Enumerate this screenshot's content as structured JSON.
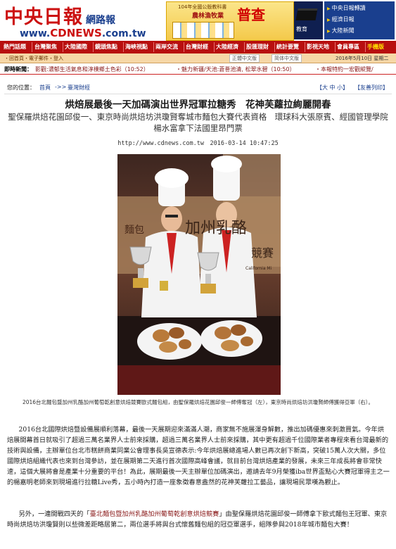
{
  "header": {
    "logo_title": "中央日報",
    "logo_sub": "網路報",
    "logo_url_prefix": "www.",
    "logo_url_brand": "CDNEWS",
    "logo_url_suffix": ".com.tw",
    "ad_label": "104年全國公版教科書",
    "ad_title": "農林漁牧業",
    "ad_big": "普查",
    "ad2_text": "教育",
    "right_links": [
      "中央日報轉讀",
      "經濟日報",
      "大陸新聞"
    ]
  },
  "nav": {
    "items": [
      "熱門話題",
      "台灣聚焦",
      "大陸國際",
      "鏡頭焦點",
      "海峽視點",
      "兩岸交流",
      "台灣財經",
      "大陸經濟",
      "股匯理財",
      "統計要覽",
      "影視天地",
      "會員專區",
      "手機版"
    ]
  },
  "subbar": {
    "left": "・回首頁・電子郵件・登入",
    "btn_traditional": "正體中文版",
    "btn_simplified": "简体中文版",
    "date": "2016年5月10日 星期二"
  },
  "ticker": {
    "label": "即時新聞：",
    "items": [
      "影觀:濃郁生活氣息和淳樸鄉土色彩（10:52）",
      "・魅力新疆/天池:蒼巻池清, 松翠水碧（10:50）",
      "・本報特約一宏觀縱覽/"
    ]
  },
  "breadcrumb": {
    "label": "您的位置：",
    "home": "首頁",
    "sep": "->>",
    "section": "臺灣財經",
    "font_size_label": "【大 中 小】",
    "print_label": "【友善列印】"
  },
  "article": {
    "headline": "烘焙展最後一天加碼演出世界冠軍拉糖秀　花神芙蘿拉絢麗開春",
    "subhead": "聖保羅烘焙花園邱俊一、東京時尚烘焙坊洪瓊賢奪城市麵包大賽代表資格　環球科大張原賓、經國管理學院楊水富拿下法國里昂門票",
    "meta": "http://www.cdnews.com.tw　2016-03-14 10:47:25",
    "photo_sign_top": "麵包",
    "photo_sign_main": "加州乳酪",
    "photo_sign_main2": "競賽",
    "photo_sign_small": "California Mi",
    "caption": "2016台北麵包暨加州乳酪加州葡萄乾創意烘焙競賽歐式麵包組，由聖保羅烘焙花園邱俊一師傅奪冠（左），東京時尚烘焙坊洪瓊賢師傅獲得亞軍（右）。",
    "para1": "2016台北國際烘焙暨設備展順利落幕，最後一天展期迎來滿滿人潮，商家無不施展渾身解數，推出加碼優惠來刺激買氣。今年烘焙展開幕首日就吸引了超過三萬名業界人士前來採購，超過三萬名業界人士前來採購，其中更有超過千位國際業者專程來看台灣最新的技術與設備，主辦單位台北市糕餅商業同業公會理事長吳宣德表示:今年烘焙展總進場人數已再次創下新高，突破15萬人次大關，多位國際烘焙組織代表也來到台灣參訪，並在展期第二天進行首次國際高峰會議，就目前台灣烘焙產業的發展，未來三年成長將會非常快速，這個大展將會是產業十分重要的平台！為此，展期最後一天主辦單位加碼演出，邀請去年9月榮獲iba世界盃點心大賽冠軍得主之一的楊嘉明老師來到現場進行拉糖Live秀，五小時內打造一座象徵春意盎然的花神芙蘿拉工藝品，讓現場民眾嘆為觀止。",
    "para2_prefix": "另外，一連開戰四天的「",
    "para2_link": "臺北麵包暨加州乳酪加州葡萄乾創意烘焙競賽",
    "para2_suffix": "」由聖保羅烘焙花園邱俊一師傅拿下歐式麵包王冠軍、東京時尚烘焙坊洪瓊賢則以些微差距略居第二，兩位選手將與台式懷舊麵包組的冠亞軍選手，組隊參與2018年城市麵包大賽！"
  },
  "colors": {
    "brand_red": "#cc1111",
    "brand_blue": "#1a3f8e",
    "nav_red": "#b80f0f",
    "subbar_tan": "#f6d7a6"
  }
}
